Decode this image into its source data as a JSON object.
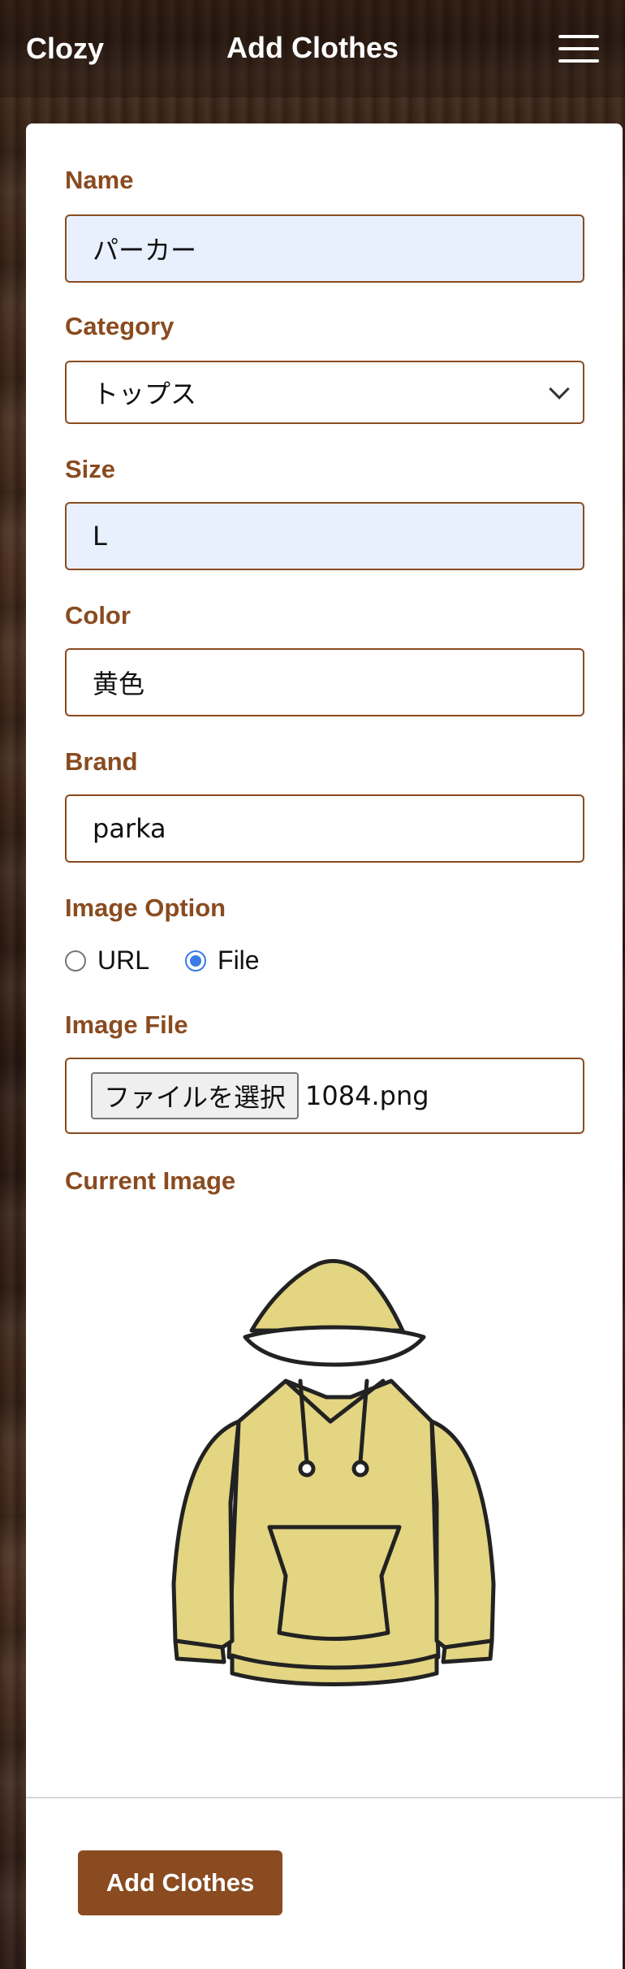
{
  "nav": {
    "brand": "Clozy",
    "title": "Add Clothes",
    "menu_icon": "hamburger-menu-icon"
  },
  "form": {
    "name_label": "Name",
    "name_value": "パーカー",
    "category_label": "Category",
    "category_value": "トップス",
    "size_label": "Size",
    "size_value": "L",
    "color_label": "Color",
    "color_value": "黄色",
    "brand_label": "Brand",
    "brand_value": "parka",
    "image_option_label": "Image Option",
    "image_option_url": "URL",
    "image_option_file": "File",
    "image_option_selected": "File",
    "image_file_label": "Image File",
    "file_button": "ファイルを選択",
    "file_name": "1084.png",
    "current_image_label": "Current Image",
    "current_image_icon": "hoodie-image",
    "submit_label": "Add Clothes"
  },
  "colors": {
    "accent": "#8a4b20",
    "autofill_bg": "#e8f0fe",
    "radio_checked": "#3b7be8",
    "hoodie_fill": "#e3d581"
  }
}
